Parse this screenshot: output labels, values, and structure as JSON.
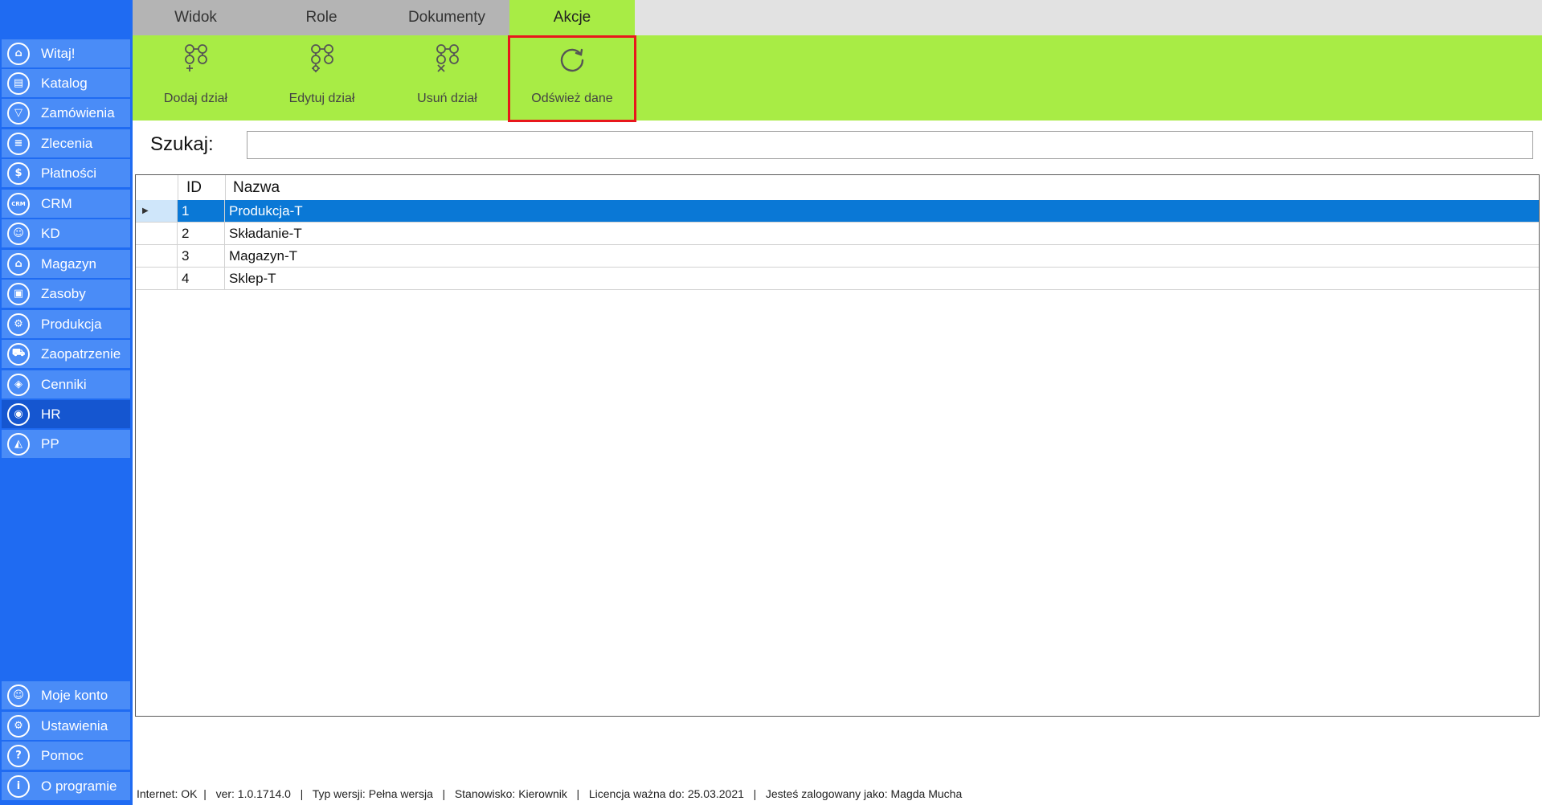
{
  "sidebar": {
    "items": [
      {
        "label": "Witaj!",
        "icon": "home-icon",
        "glyph": "⌂"
      },
      {
        "label": "Katalog",
        "icon": "book-icon",
        "glyph": "▤"
      },
      {
        "label": "Zamówienia",
        "icon": "cart-icon",
        "glyph": "▽"
      },
      {
        "label": "Zlecenia",
        "icon": "list-icon",
        "glyph": "≡"
      },
      {
        "label": "Płatności",
        "icon": "dollar-icon",
        "glyph": "$"
      },
      {
        "label": "CRM",
        "icon": "crm-icon",
        "glyph": "CRM"
      },
      {
        "label": "KD",
        "icon": "person-icon",
        "glyph": "☺"
      },
      {
        "label": "Magazyn",
        "icon": "warehouse-icon",
        "glyph": "⌂"
      },
      {
        "label": "Zasoby",
        "icon": "box-icon",
        "glyph": "▣"
      },
      {
        "label": "Produkcja",
        "icon": "production-icon",
        "glyph": "⚙"
      },
      {
        "label": "Zaopatrzenie",
        "icon": "truck-icon",
        "glyph": "⛟"
      },
      {
        "label": "Cenniki",
        "icon": "tag-icon",
        "glyph": "◈"
      },
      {
        "label": "HR",
        "icon": "hr-icon",
        "glyph": "◉"
      },
      {
        "label": "PP",
        "icon": "pp-icon",
        "glyph": "◭"
      }
    ],
    "bottom_items": [
      {
        "label": "Moje konto",
        "icon": "user-icon",
        "glyph": "☺"
      },
      {
        "label": "Ustawienia",
        "icon": "gear-icon",
        "glyph": "⚙"
      },
      {
        "label": "Pomoc",
        "icon": "help-icon",
        "glyph": "?"
      },
      {
        "label": "O programie",
        "icon": "info-icon",
        "glyph": "i"
      }
    ]
  },
  "tabs": [
    {
      "label": "Widok"
    },
    {
      "label": "Role"
    },
    {
      "label": "Dokumenty"
    },
    {
      "label": "Akcje"
    }
  ],
  "ribbon": {
    "buttons": [
      {
        "label": "Dodaj dział",
        "icon": "add-department-icon"
      },
      {
        "label": "Edytuj dział",
        "icon": "edit-department-icon"
      },
      {
        "label": "Usuń dział",
        "icon": "delete-department-icon"
      },
      {
        "label": "Odśwież dane",
        "icon": "refresh-icon"
      }
    ]
  },
  "search": {
    "label": "Szukaj:",
    "value": ""
  },
  "grid": {
    "columns": [
      "ID",
      "Nazwa"
    ],
    "rows": [
      {
        "id": "1",
        "name": "Produkcja-T"
      },
      {
        "id": "2",
        "name": "Składanie-T"
      },
      {
        "id": "3",
        "name": "Magazyn-T"
      },
      {
        "id": "4",
        "name": "Sklep-T"
      }
    ]
  },
  "status": {
    "text": "Internet: OK  |   ver: 1.0.1714.0   |   Typ wersji: Pełna wersja   |   Stanowisko: Kierownik   |   Licencja ważna do: 25.03.2021   |   Jesteś zalogowany jako: Magda Mucha"
  },
  "colors": {
    "sidebar_bg": "#1f6bf2",
    "nav_item": "#4a8cf7",
    "nav_active": "#1556d0",
    "ribbon_bg": "#a8ec45",
    "selection": "#0a78d6",
    "highlight_border": "#e8171c"
  }
}
